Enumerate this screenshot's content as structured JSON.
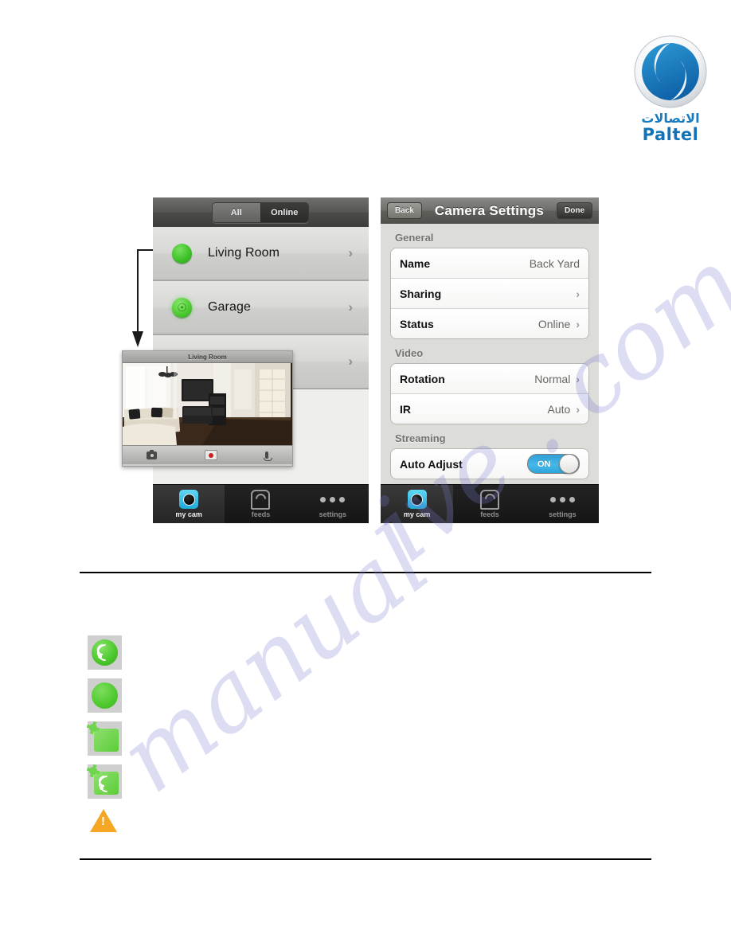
{
  "brand": {
    "name": "Paltel",
    "arabic_name": "الاتصالات",
    "logo_icon": "paltel-swirl-logo",
    "primary_color": "#1172b8"
  },
  "watermark": {
    "line1": "manual",
    "line2": "ive . com"
  },
  "phone_left": {
    "screen_name": "my-cam-camera-list",
    "segmented_control": {
      "options": [
        "All",
        "Online"
      ],
      "selected": "Online"
    },
    "cameras": [
      {
        "name": "Living Room",
        "status_icon": "green-status-dot",
        "chevron": "›"
      },
      {
        "name": "Garage",
        "status_icon": "green-lock-dot",
        "lock_glyph": "⚷",
        "chevron": "›"
      },
      {
        "name": "",
        "status_icon": "",
        "chevron": "›"
      }
    ],
    "video_preview": {
      "title": "Living Room",
      "controls": [
        {
          "icon": "snapshot-icon",
          "label": "Snapshot"
        },
        {
          "icon": "record-icon",
          "label": "Record"
        },
        {
          "icon": "microphone-icon",
          "label": "Talk"
        }
      ]
    },
    "tabbar": {
      "items": [
        {
          "label": "my cam",
          "icon": "camera-lens-icon",
          "active": true
        },
        {
          "label": "feeds",
          "icon": "feeds-wifi-icon",
          "active": false
        },
        {
          "label": "settings",
          "icon": "three-dots-icon",
          "active": false
        }
      ]
    }
  },
  "phone_right": {
    "nav": {
      "back_label": "Back",
      "title": "Camera Settings",
      "done_label": "Done"
    },
    "sections": [
      {
        "title": "General",
        "rows": [
          {
            "label": "Name",
            "value": "Back Yard",
            "chevron": ""
          },
          {
            "label": "Sharing",
            "value": "",
            "chevron": "›"
          },
          {
            "label": "Status",
            "value": "Online",
            "chevron": "›"
          }
        ]
      },
      {
        "title": "Video",
        "rows": [
          {
            "label": "Rotation",
            "value": "Normal",
            "chevron": "›"
          },
          {
            "label": "IR",
            "value": "Auto",
            "chevron": "›"
          }
        ]
      },
      {
        "title": "Streaming",
        "rows": [
          {
            "label": "Auto Adjust",
            "toggle": "ON"
          }
        ]
      }
    ],
    "tabbar": {
      "items": [
        {
          "label": "my cam",
          "icon": "camera-lens-icon",
          "active": true
        },
        {
          "label": "feeds",
          "icon": "feeds-wifi-icon",
          "active": false
        },
        {
          "label": "settings",
          "icon": "three-dots-icon",
          "active": false
        }
      ]
    }
  },
  "legend": {
    "icons": [
      {
        "name": "green-circle-wifi-icon"
      },
      {
        "name": "green-circle-icon"
      },
      {
        "name": "green-square-sun-icon"
      },
      {
        "name": "green-square-sun-wifi-icon"
      },
      {
        "name": "orange-warning-triangle-icon"
      }
    ]
  },
  "annotation": {
    "arrow": "down-arrow-annotation"
  }
}
